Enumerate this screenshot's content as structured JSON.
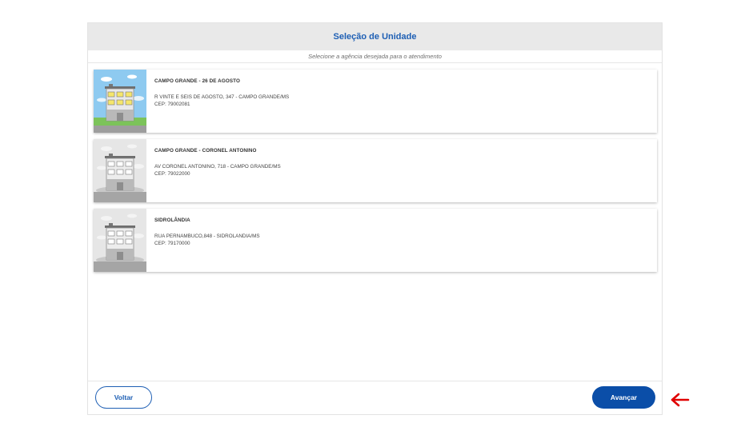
{
  "header": {
    "title": "Seleção de Unidade"
  },
  "subtitle": "Selecione a agência desejada para o atendimento",
  "units": [
    {
      "name": "CAMPO GRANDE - 26 DE AGOSTO",
      "address": "R VINTE E SEIS DE AGOSTO, 347 - CAMPO GRANDE/MS",
      "cep": "CEP: 79002081",
      "selected": true
    },
    {
      "name": "CAMPO GRANDE - CORONEL ANTONINO",
      "address": "AV CORONEL ANTONINO, 718 - CAMPO GRANDE/MS",
      "cep": "CEP: 79022000",
      "selected": false
    },
    {
      "name": "SIDROLÂNDIA",
      "address": "RUA PERNAMBUCO,848 - SIDROLANDIA/MS",
      "cep": "CEP: 79170000",
      "selected": false
    }
  ],
  "footer": {
    "back_label": "Voltar",
    "next_label": "Avançar"
  },
  "colors": {
    "accent": "#0b4ea8",
    "title": "#1e5fb4",
    "annotation_arrow": "#e00000"
  },
  "icons": {
    "unit_image": "building-icon",
    "annotation": "arrow-left-icon"
  }
}
